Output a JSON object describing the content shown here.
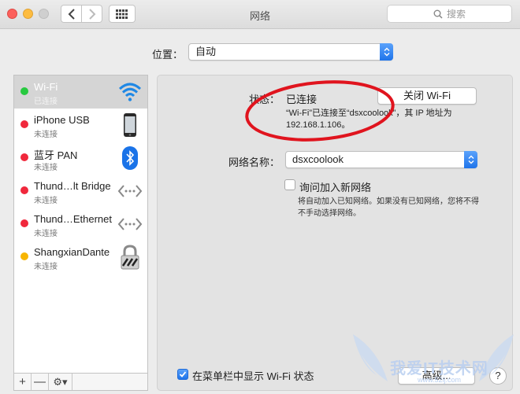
{
  "window": {
    "title": "网络"
  },
  "search": {
    "placeholder": "搜索"
  },
  "location": {
    "label": "位置：",
    "value": "自动"
  },
  "services": [
    {
      "name": "Wi-Fi",
      "status": "已连接",
      "dot_color": "#27c93f",
      "icon": "wifi-icon"
    },
    {
      "name": "iPhone USB",
      "status": "未连接",
      "dot_color": "#f0283c",
      "icon": "iphone-icon"
    },
    {
      "name": "蓝牙 PAN",
      "status": "未连接",
      "dot_color": "#f0283c",
      "icon": "bluetooth-icon"
    },
    {
      "name": "Thund…lt Bridge",
      "status": "未连接",
      "dot_color": "#f0283c",
      "icon": "thunderbolt-bridge-icon"
    },
    {
      "name": "Thund…Ethernet",
      "status": "未连接",
      "dot_color": "#f0283c",
      "icon": "thunderbolt-ethernet-icon"
    },
    {
      "name": "ShangxianDante",
      "status": "未连接",
      "dot_color": "#f7b500",
      "icon": "lock-icon"
    }
  ],
  "sidebar_tools": {
    "add": "+",
    "remove": "—"
  },
  "detail": {
    "status_label": "状态：",
    "status_value": "已连接",
    "turn_off_button": "关闭 Wi-Fi",
    "status_note": "“Wi-Fi”已连接至“dsxcoolook”，其 IP 地址为 192.168.1.106。",
    "network_name_label": "网络名称：",
    "network_name_value": "dsxcoolook",
    "ask_join_label": "询问加入新网络",
    "ask_join_checked": false,
    "ask_join_note": "将自动加入已知网络。如果没有已知网络，您将不得不手动选择网络。",
    "show_menubar_label": "在菜单栏中显示 Wi-Fi 状态",
    "show_menubar_checked": true,
    "advanced_button": "高级...",
    "help_button": "?"
  },
  "watermark": {
    "text": "我爱IT技术网",
    "url": "www.52ij.com"
  },
  "colors": {
    "accent": "#1f74ea",
    "annotation": "#e0141e",
    "selected_row": "#d5d5d5"
  }
}
